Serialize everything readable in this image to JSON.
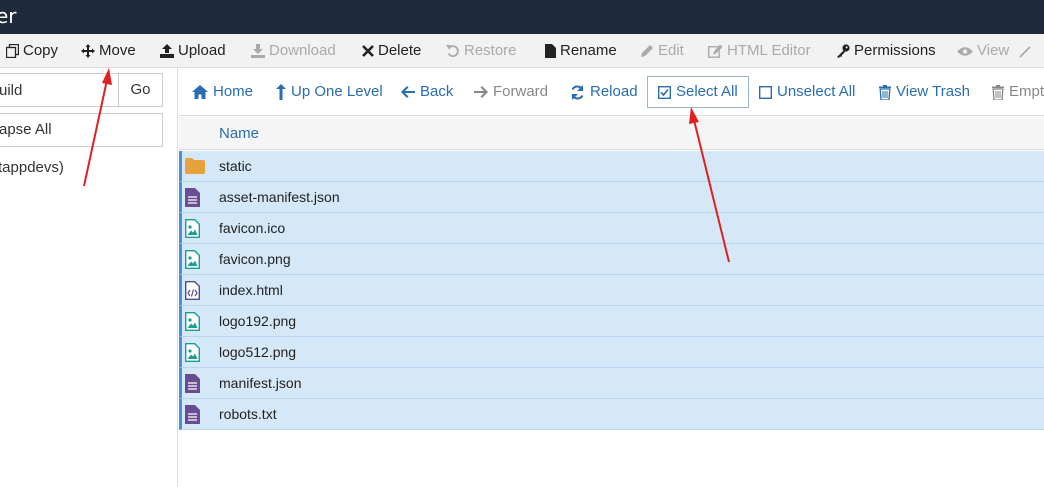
{
  "window": {
    "title_fragment": "er"
  },
  "toolbar": {
    "copy": "Copy",
    "move": "Move",
    "upload": "Upload",
    "download": "Download",
    "delete": "Delete",
    "restore": "Restore",
    "rename": "Rename",
    "edit": "Edit",
    "html_editor": "HTML Editor",
    "permissions": "Permissions",
    "view": "View"
  },
  "sidebar": {
    "path_value": "uild",
    "go": "Go",
    "collapse_all": "apse All",
    "tree_item": "tappdevs)"
  },
  "nav": {
    "home": "Home",
    "up_one_level": "Up One Level",
    "back": "Back",
    "forward": "Forward",
    "reload": "Reload",
    "select_all": "Select All",
    "unselect_all": "Unselect All",
    "view_trash": "View Trash",
    "empty": "Empty"
  },
  "grid": {
    "name_header": "Name",
    "files": [
      {
        "name": "static",
        "icon": "folder-icon"
      },
      {
        "name": "asset-manifest.json",
        "icon": "file-text-icon"
      },
      {
        "name": "favicon.ico",
        "icon": "file-image-icon"
      },
      {
        "name": "favicon.png",
        "icon": "file-image-icon"
      },
      {
        "name": "index.html",
        "icon": "file-code-icon"
      },
      {
        "name": "logo192.png",
        "icon": "file-image-icon"
      },
      {
        "name": "logo512.png",
        "icon": "file-image-icon"
      },
      {
        "name": "manifest.json",
        "icon": "file-text-icon"
      },
      {
        "name": "robots.txt",
        "icon": "file-text-icon"
      }
    ]
  },
  "colors": {
    "titlebar": "#1f2b3a",
    "link_blue": "#2a6db0",
    "selected_row": "#d5e8f8",
    "annotation_arrow": "#e02020",
    "folder": "#e6a23c",
    "file_text": "#6a4c93",
    "file_image": "#1a9e8f"
  }
}
